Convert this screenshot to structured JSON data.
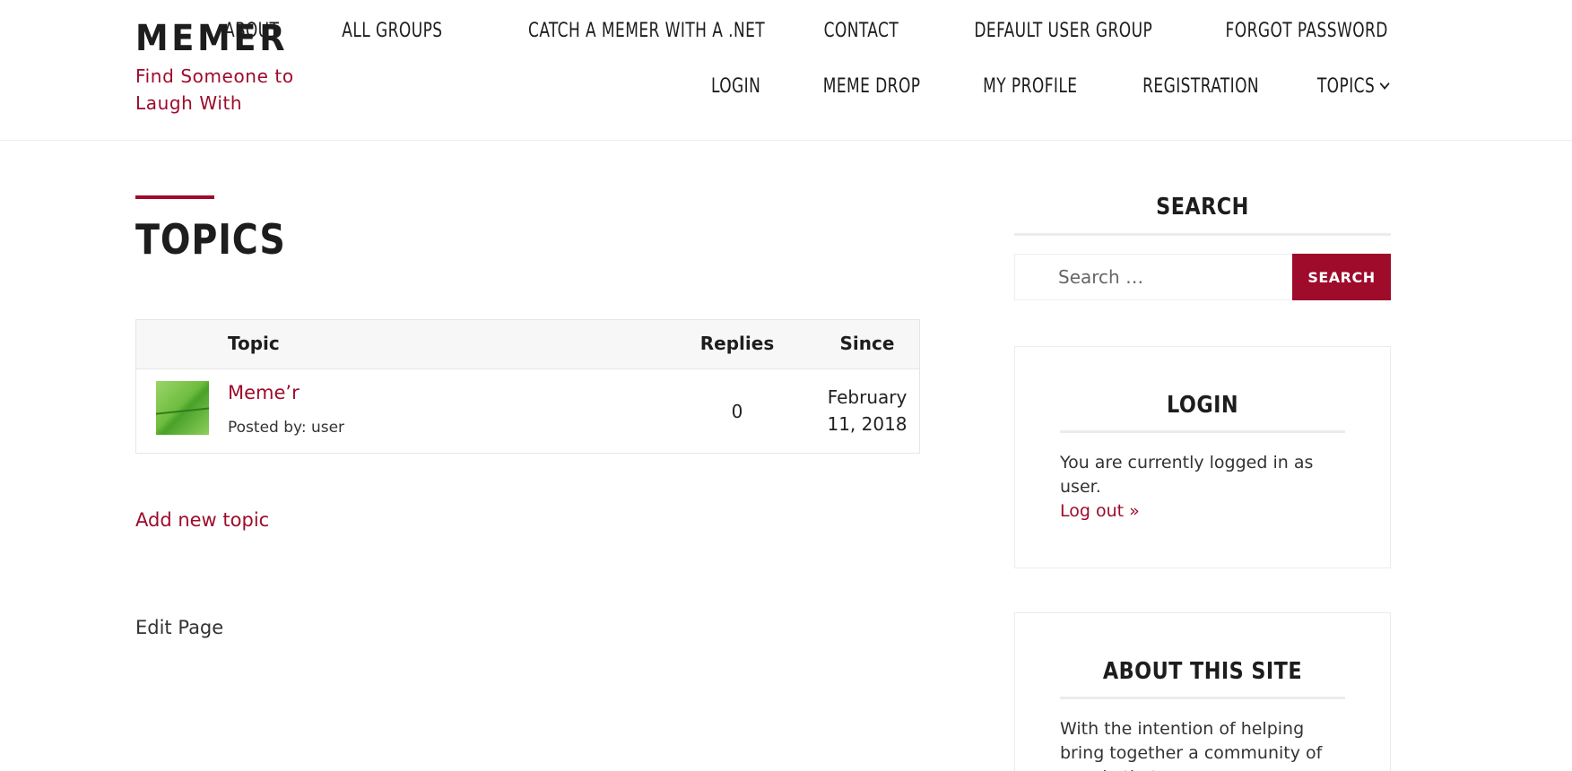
{
  "site": {
    "title": "MEMER",
    "tagline": "Find Someone to Laugh With"
  },
  "nav": {
    "row1": [
      "ABOUT",
      "ALL GROUPS",
      "CATCH A MEMER WITH A .NET",
      "CONTACT",
      "DEFAULT USER GROUP",
      "FORGOT PASSWORD"
    ],
    "row2": [
      "LOGIN",
      "MEME DROP",
      "MY PROFILE",
      "REGISTRATION",
      "TOPICS"
    ],
    "topics_chevron_icon": "chevron-down-icon"
  },
  "main": {
    "title": "TOPICS",
    "table": {
      "headers": {
        "topic": "Topic",
        "replies": "Replies",
        "since": "Since"
      },
      "rows": [
        {
          "title": "Meme’r",
          "posted_by": "Posted by: user",
          "replies": "0",
          "since": "February 11, 2018",
          "thumbnail": "green-leaf-thumbnail"
        }
      ]
    },
    "add_topic_label": "Add new topic",
    "edit_page_label": "Edit Page"
  },
  "sidebar": {
    "search": {
      "title": "SEARCH",
      "placeholder": "Search …",
      "button_label": "Search"
    },
    "login": {
      "title": "LOGIN",
      "status_text": "You are currently logged in as user.",
      "logout_label": "Log out »"
    },
    "about": {
      "title": "ABOUT THIS SITE",
      "text": "With the intention of helping bring together a community of people that"
    }
  },
  "colors": {
    "accent": "#9e0b2b",
    "text": "#1d1d1d",
    "border": "#ececec"
  }
}
